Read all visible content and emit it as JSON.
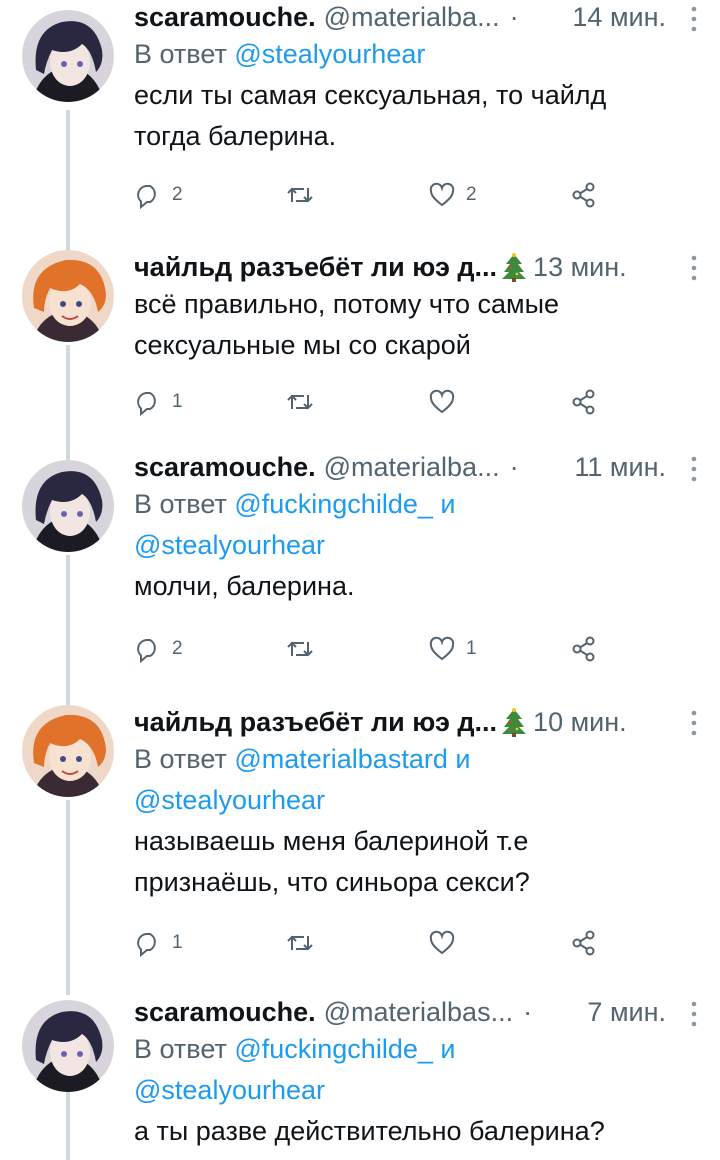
{
  "tweets": [
    {
      "author": "scaramouche.",
      "handle": "@materialba...",
      "time": "14 мин.",
      "reply_prefix": "В ответ",
      "reply_mention_1": "@stealyourhear",
      "reply_and": "",
      "reply_mention_2": "",
      "text_line_1": "если ты самая сексуальная, то чайлд",
      "text_line_2": "тогда балерина.",
      "replies": "2",
      "retweets": "",
      "likes": "2"
    },
    {
      "author": "чайльд разъебёт ли юэ д...",
      "handle": "",
      "time": "13 мин.",
      "reply_prefix": "",
      "reply_mention_1": "",
      "reply_and": "",
      "reply_mention_2": "",
      "text_line_1": "всё правильно, потому что самые",
      "text_line_2": "сексуальные мы со скарой",
      "replies": "1",
      "retweets": "",
      "likes": ""
    },
    {
      "author": "scaramouche.",
      "handle": "@materialba...",
      "time": "11 мин.",
      "reply_prefix": "В ответ",
      "reply_mention_1": "@fuckingchilde_",
      "reply_and": "и",
      "reply_mention_2": "@stealyourhear",
      "text_line_1": "молчи, балерина.",
      "text_line_2": "",
      "replies": "2",
      "retweets": "",
      "likes": "1"
    },
    {
      "author": "чайльд разъебёт ли юэ д...",
      "handle": "",
      "time": "10 мин.",
      "reply_prefix": "В ответ",
      "reply_mention_1": "@materialbastard",
      "reply_and": "и",
      "reply_mention_2": "@stealyourhear",
      "text_line_1": "называешь меня балериной т.е",
      "text_line_2": "признаёшь, что синьора секси?",
      "replies": "1",
      "retweets": "",
      "likes": ""
    },
    {
      "author": "scaramouche.",
      "handle": "@materialbas...",
      "time": "7 мин.",
      "reply_prefix": "В ответ",
      "reply_mention_1": "@fuckingchilde_",
      "reply_and": "и",
      "reply_mention_2": "@stealyourhear",
      "text_line_1": "а ты разве действительно балерина?",
      "text_line_2": "",
      "replies": "",
      "retweets": "",
      "likes": ""
    }
  ],
  "colors": {
    "link": "#1d9bf0",
    "secondary": "#536471",
    "text": "#0f1419",
    "thread": "#cfd9de"
  },
  "icons": [
    "reply-icon",
    "retweet-icon",
    "like-icon",
    "share-icon",
    "more-icon",
    "christmas-tree-icon"
  ]
}
